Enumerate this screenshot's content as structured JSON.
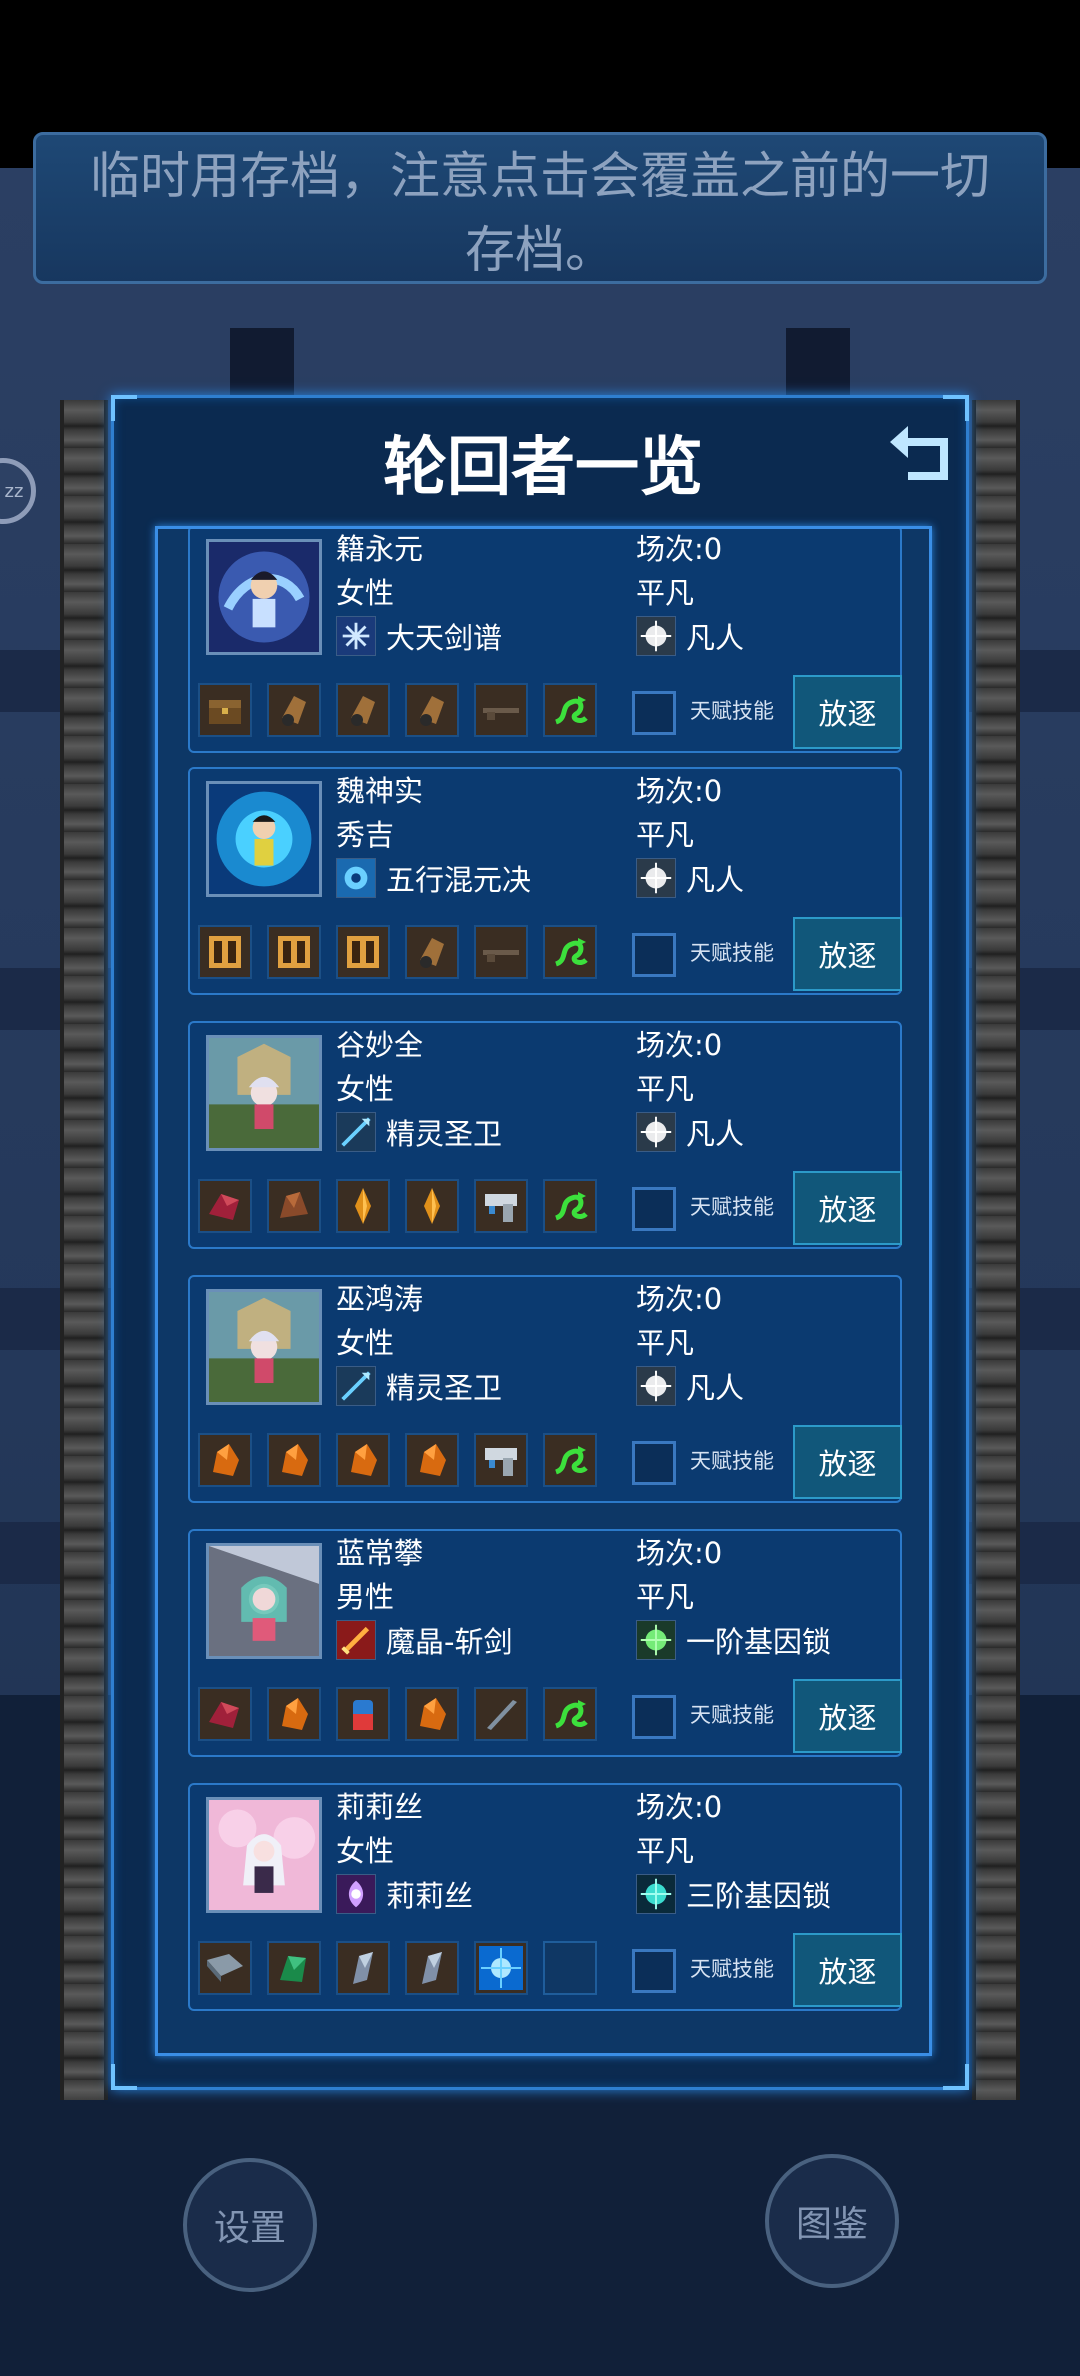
{
  "notice": {
    "line1": "临时用存档，注意点击会覆盖之前的一切",
    "line2": "存档。"
  },
  "panel": {
    "title": "轮回者一览",
    "talent_label": "天赋技能",
    "exile_label": "放逐"
  },
  "side_icon": {
    "text": "zz"
  },
  "bottom": {
    "settings": "设置",
    "codex": "图鉴"
  },
  "characters": [
    {
      "name": "籍永元",
      "gender": "女性",
      "count": "场次:0",
      "rank": "平凡",
      "skill": "大天剑谱",
      "realm": "凡人",
      "slots": [
        "chest-icon",
        "gloves-icon",
        "gloves-icon",
        "gloves-icon",
        "rifle-icon",
        "dragon-emblem-icon"
      ]
    },
    {
      "name": "魏神实",
      "gender": "秀吉",
      "count": "场次:0",
      "rank": "平凡",
      "skill": "五行混元决",
      "realm": "凡人",
      "slots": [
        "crate-icon",
        "crate-icon",
        "crate-icon",
        "gloves-icon",
        "rifle-icon",
        "dragon-emblem-icon"
      ]
    },
    {
      "name": "谷妙全",
      "gender": "女性",
      "count": "场次:0",
      "rank": "平凡",
      "skill": "精灵圣卫",
      "realm": "凡人",
      "slots": [
        "red-ore-icon",
        "brown-ore-icon",
        "amber-crystal-icon",
        "amber-crystal-icon",
        "pistol-icon",
        "dragon-emblem-icon"
      ]
    },
    {
      "name": "巫鸿涛",
      "gender": "女性",
      "count": "场次:0",
      "rank": "平凡",
      "skill": "精灵圣卫",
      "realm": "凡人",
      "slots": [
        "orange-ore-icon",
        "orange-ore-icon",
        "orange-ore-icon",
        "orange-ore-icon",
        "pistol-icon",
        "dragon-emblem-icon"
      ]
    },
    {
      "name": "蓝常攀",
      "gender": "男性",
      "count": "场次:0",
      "rank": "平凡",
      "skill": "魔晶-斩剑",
      "realm": "一阶基因锁",
      "slots": [
        "red-ore-icon",
        "orange-ore-icon",
        "potion-icon",
        "orange-ore-icon",
        "dagger-icon",
        "dragon-emblem-icon"
      ]
    },
    {
      "name": "莉莉丝",
      "gender": "女性",
      "count": "场次:0",
      "rank": "平凡",
      "skill": "莉莉丝",
      "realm": "三阶基因锁",
      "slots": [
        "book-icon",
        "green-ore-icon",
        "steel-shard-icon",
        "steel-shard-icon",
        "blue-orb-icon",
        ""
      ]
    }
  ],
  "colors": {
    "accent": "#2f7fd0",
    "panel": "#0b2a50",
    "button": "#11577a"
  }
}
